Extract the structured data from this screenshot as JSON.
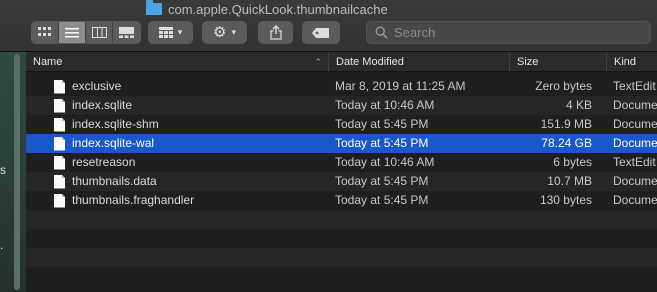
{
  "window": {
    "title": "com.apple.QuickLook.thumbnailcache"
  },
  "toolbar": {
    "view_modes": [
      "icon-view",
      "list-view",
      "column-view",
      "gallery-view"
    ],
    "active_view": "list-view",
    "search": {
      "placeholder": "Search",
      "value": ""
    }
  },
  "columns": {
    "name": "Name",
    "date": "Date Modified",
    "size": "Size",
    "kind": "Kind"
  },
  "files": [
    {
      "name": "exclusive",
      "date": "Mar 8, 2019 at 11:25 AM",
      "size": "Zero bytes",
      "kind": "TextEdit"
    },
    {
      "name": "index.sqlite",
      "date": "Today at 10:46 AM",
      "size": "4 KB",
      "kind": "Document"
    },
    {
      "name": "index.sqlite-shm",
      "date": "Today at 5:45 PM",
      "size": "151.9 MB",
      "kind": "Document"
    },
    {
      "name": "index.sqlite-wal",
      "date": "Today at 5:45 PM",
      "size": "78.24 GB",
      "kind": "Document",
      "selected": true
    },
    {
      "name": "resetreason",
      "date": "Today at 10:46 AM",
      "size": "6 bytes",
      "kind": "TextEdit"
    },
    {
      "name": "thumbnails.data",
      "date": "Today at 5:45 PM",
      "size": "10.7 MB",
      "kind": "Document"
    },
    {
      "name": "thumbnails.fraghandler",
      "date": "Today at 5:45 PM",
      "size": "130 bytes",
      "kind": "Document"
    }
  ],
  "sidebar_fragments": [
    "s",
    "."
  ],
  "colors": {
    "selection": "#1a57c9",
    "folder": "#4aa6e0"
  }
}
